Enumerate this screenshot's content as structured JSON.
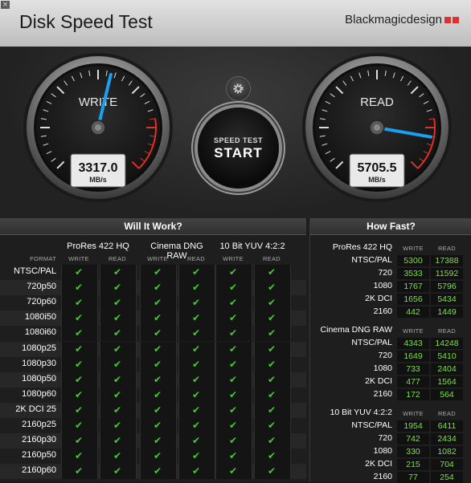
{
  "window": {
    "close_glyph": "×",
    "title": "Disk Speed Test",
    "brand": "Blackmagicdesign"
  },
  "gauges": {
    "write": {
      "label": "WRITE",
      "value": "3317.0",
      "unit": "MB/s",
      "fraction": 0.55
    },
    "read": {
      "label": "READ",
      "value": "5705.5",
      "unit": "MB/s",
      "fraction": 0.87
    }
  },
  "start": {
    "sub": "SPEED TEST",
    "main": "START"
  },
  "settings_icon": "gear-icon",
  "will_it_work": {
    "title": "Will It Work?",
    "format_label": "FORMAT",
    "codecs": [
      "ProRes 422 HQ",
      "Cinema DNG RAW",
      "10 Bit YUV 4:2:2"
    ],
    "write_label": "WRITE",
    "read_label": "READ",
    "check_glyph": "✔",
    "formats": [
      "NTSC/PAL",
      "720p50",
      "720p60",
      "1080i50",
      "1080i60",
      "1080p25",
      "1080p30",
      "1080p50",
      "1080p60",
      "2K DCI 25",
      "2160p25",
      "2160p30",
      "2160p50",
      "2160p60"
    ]
  },
  "how_fast": {
    "title": "How Fast?",
    "write_label": "WRITE",
    "read_label": "READ",
    "groups": [
      {
        "codec": "ProRes 422 HQ",
        "rows": [
          {
            "fmt": "NTSC/PAL",
            "write": "5300",
            "read": "17388"
          },
          {
            "fmt": "720",
            "write": "3533",
            "read": "11592"
          },
          {
            "fmt": "1080",
            "write": "1767",
            "read": "5796"
          },
          {
            "fmt": "2K DCI",
            "write": "1656",
            "read": "5434"
          },
          {
            "fmt": "2160",
            "write": "442",
            "read": "1449"
          }
        ]
      },
      {
        "codec": "Cinema DNG RAW",
        "rows": [
          {
            "fmt": "NTSC/PAL",
            "write": "4343",
            "read": "14248"
          },
          {
            "fmt": "720",
            "write": "1649",
            "read": "5410"
          },
          {
            "fmt": "1080",
            "write": "733",
            "read": "2404"
          },
          {
            "fmt": "2K DCI",
            "write": "477",
            "read": "1564"
          },
          {
            "fmt": "2160",
            "write": "172",
            "read": "564"
          }
        ]
      },
      {
        "codec": "10 Bit YUV 4:2:2",
        "rows": [
          {
            "fmt": "NTSC/PAL",
            "write": "1954",
            "read": "6411"
          },
          {
            "fmt": "720",
            "write": "742",
            "read": "2434"
          },
          {
            "fmt": "1080",
            "write": "330",
            "read": "1082"
          },
          {
            "fmt": "2K DCI",
            "write": "215",
            "read": "704"
          },
          {
            "fmt": "2160",
            "write": "77",
            "read": "254"
          }
        ]
      }
    ]
  },
  "colors": {
    "check": "#3fd12a",
    "value": "#7ce046",
    "needle": "#1aa0f0",
    "redzone": "#e0302a"
  }
}
